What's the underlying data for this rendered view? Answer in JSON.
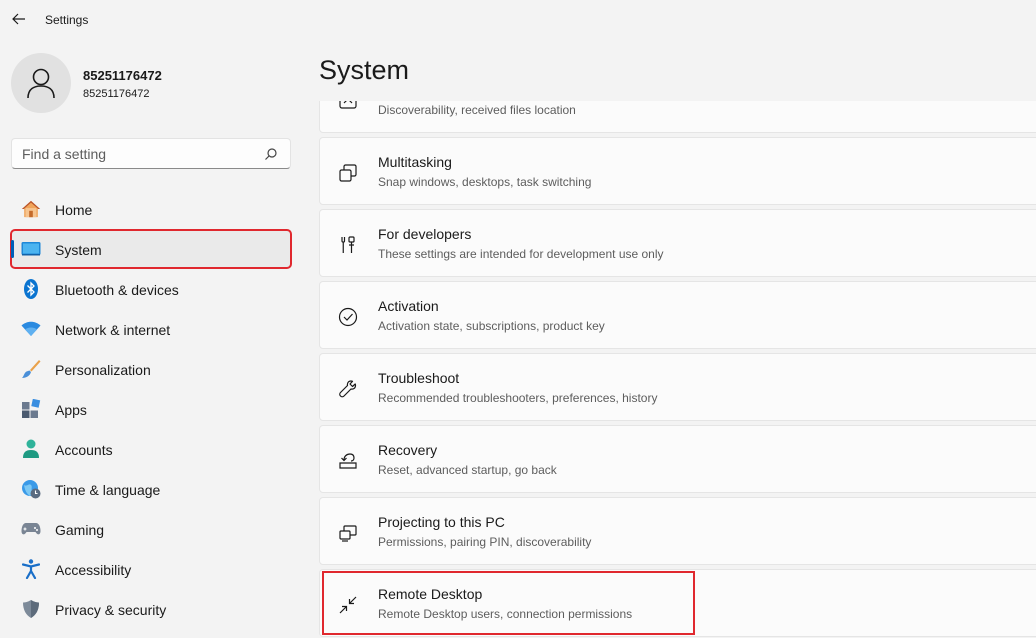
{
  "app": {
    "title": "Settings"
  },
  "user": {
    "name": "85251176472",
    "email": "85251176472"
  },
  "search": {
    "placeholder": "Find a setting"
  },
  "nav": {
    "items": [
      {
        "label": "Home",
        "icon": "home-icon"
      },
      {
        "label": "System",
        "icon": "system-icon",
        "active": true
      },
      {
        "label": "Bluetooth & devices",
        "icon": "bluetooth-icon"
      },
      {
        "label": "Network & internet",
        "icon": "wifi-icon"
      },
      {
        "label": "Personalization",
        "icon": "brush-icon"
      },
      {
        "label": "Apps",
        "icon": "apps-icon"
      },
      {
        "label": "Accounts",
        "icon": "accounts-icon"
      },
      {
        "label": "Time & language",
        "icon": "globe-clock-icon"
      },
      {
        "label": "Gaming",
        "icon": "gamepad-icon"
      },
      {
        "label": "Accessibility",
        "icon": "accessibility-icon"
      },
      {
        "label": "Privacy & security",
        "icon": "shield-icon"
      }
    ]
  },
  "main": {
    "title": "System",
    "cards": [
      {
        "title": "",
        "desc": "Discoverability, received files location",
        "icon": "nearby-sharing-icon"
      },
      {
        "title": "Multitasking",
        "desc": "Snap windows, desktops, task switching",
        "icon": "multitasking-icon"
      },
      {
        "title": "For developers",
        "desc": "These settings are intended for development use only",
        "icon": "developer-tools-icon"
      },
      {
        "title": "Activation",
        "desc": "Activation state, subscriptions, product key",
        "icon": "check-circle-icon"
      },
      {
        "title": "Troubleshoot",
        "desc": "Recommended troubleshooters, preferences, history",
        "icon": "wrench-icon"
      },
      {
        "title": "Recovery",
        "desc": "Reset, advanced startup, go back",
        "icon": "recovery-icon"
      },
      {
        "title": "Projecting to this PC",
        "desc": "Permissions, pairing PIN, discoverability",
        "icon": "projection-icon"
      },
      {
        "title": "Remote Desktop",
        "desc": "Remote Desktop users, connection permissions",
        "icon": "remote-desktop-icon"
      }
    ]
  },
  "colors": {
    "accent": "#005fb8",
    "highlight": "#e0282e",
    "background": "#f3f3f3",
    "card": "#fbfbfb"
  }
}
